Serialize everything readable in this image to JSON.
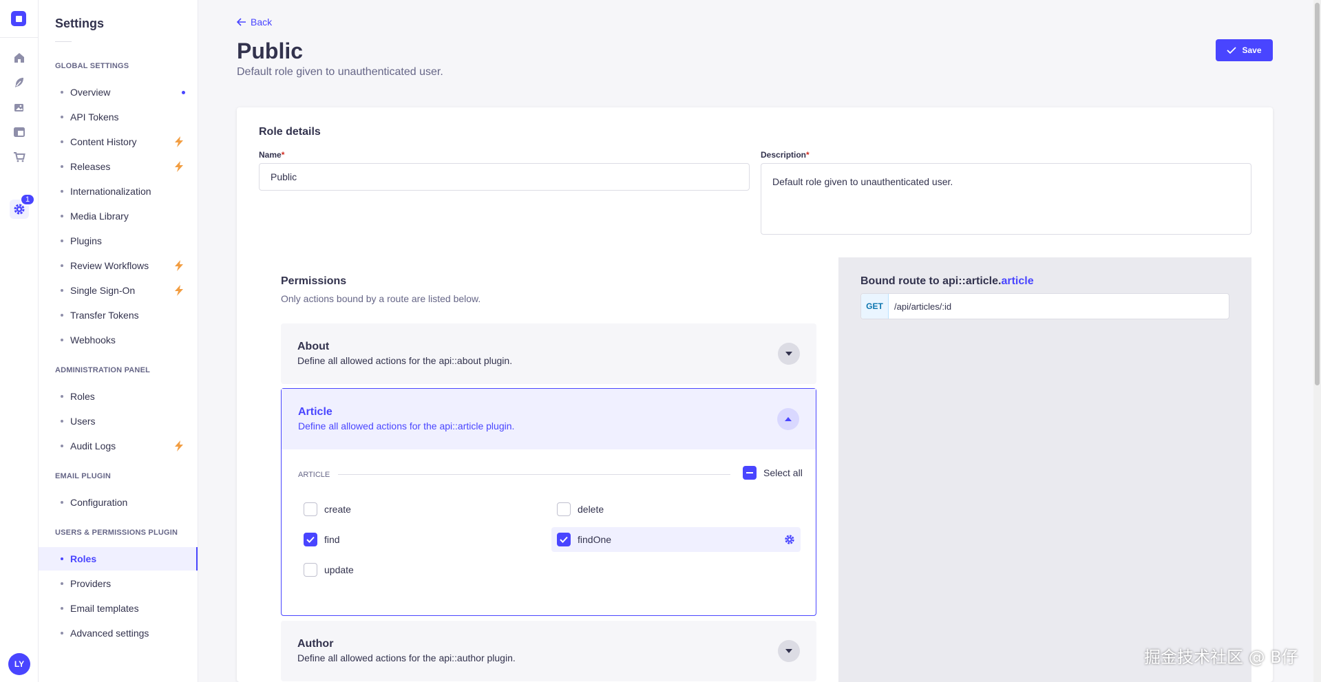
{
  "rail": {
    "badge_count": "1",
    "avatar_initials": "LY"
  },
  "sidebar": {
    "title": "Settings",
    "sections": [
      {
        "label": "Global Settings",
        "items": [
          {
            "label": "Overview",
            "marker": "dot"
          },
          {
            "label": "API Tokens"
          },
          {
            "label": "Content History",
            "marker": "bolt"
          },
          {
            "label": "Releases",
            "marker": "bolt"
          },
          {
            "label": "Internationalization"
          },
          {
            "label": "Media Library"
          },
          {
            "label": "Plugins"
          },
          {
            "label": "Review Workflows",
            "marker": "bolt"
          },
          {
            "label": "Single Sign-On",
            "marker": "bolt"
          },
          {
            "label": "Transfer Tokens"
          },
          {
            "label": "Webhooks"
          }
        ]
      },
      {
        "label": "Administration Panel",
        "items": [
          {
            "label": "Roles"
          },
          {
            "label": "Users"
          },
          {
            "label": "Audit Logs",
            "marker": "bolt"
          }
        ]
      },
      {
        "label": "Email Plugin",
        "items": [
          {
            "label": "Configuration"
          }
        ]
      },
      {
        "label": "Users & Permissions Plugin",
        "items": [
          {
            "label": "Roles",
            "active": true
          },
          {
            "label": "Providers"
          },
          {
            "label": "Email templates"
          },
          {
            "label": "Advanced settings"
          }
        ]
      }
    ]
  },
  "header": {
    "back_label": "Back",
    "title": "Public",
    "subtitle": "Default role given to unauthenticated user.",
    "save_label": "Save"
  },
  "role_details": {
    "heading": "Role details",
    "name_label": "Name",
    "name_value": "Public",
    "description_label": "Description",
    "description_value": "Default role given to unauthenticated user.",
    "required_mark": "*"
  },
  "permissions": {
    "title": "Permissions",
    "subtitle": "Only actions bound by a route are listed below.",
    "plugins": [
      {
        "title": "About",
        "description": "Define all allowed actions for the api::about plugin.",
        "open": false
      },
      {
        "title": "Article",
        "description": "Define all allowed actions for the api::article plugin.",
        "open": true
      },
      {
        "title": "Author",
        "description": "Define all allowed actions for the api::author plugin.",
        "open": false
      }
    ],
    "article_group": {
      "label": "Article",
      "select_all_label": "Select all",
      "actions": [
        {
          "label": "create",
          "checked": false
        },
        {
          "label": "delete",
          "checked": false
        },
        {
          "label": "find",
          "checked": true
        },
        {
          "label": "findOne",
          "checked": true,
          "highlighted": true
        },
        {
          "label": "update",
          "checked": false
        }
      ]
    }
  },
  "bound_route": {
    "title_prefix": "Bound route to api::article.",
    "title_highlight": "article",
    "method": "GET",
    "path": "/api/articles/:id"
  },
  "watermark": "掘金技术社区 @ B仔",
  "colors": {
    "accent": "#4945ff",
    "bolt": "#f29d41",
    "route_method": "#0c75af"
  },
  "icons": [
    "home-icon",
    "feather-icon",
    "media-icon",
    "layout-icon",
    "cart-icon",
    "gear-icon",
    "bolt-icon",
    "arrow-left-icon",
    "check-icon",
    "chevron-down-icon",
    "chevron-up-icon"
  ]
}
